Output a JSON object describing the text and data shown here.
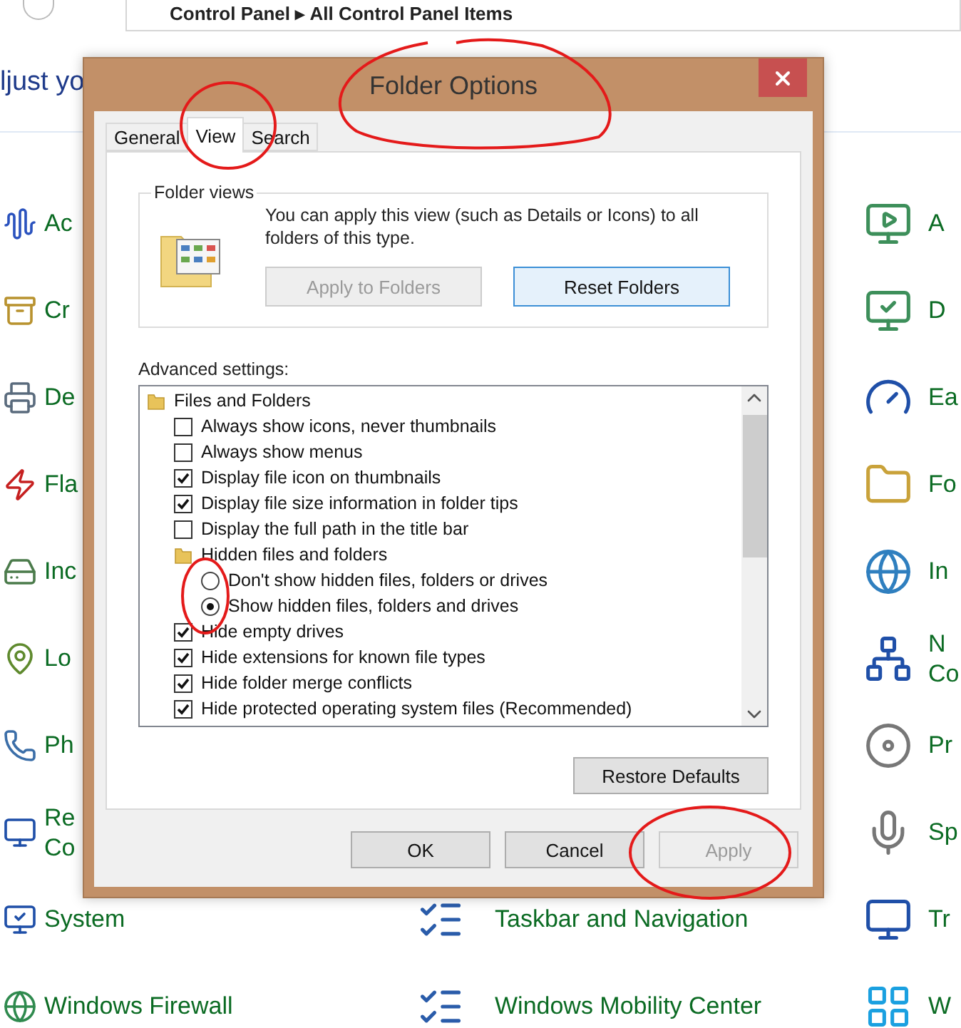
{
  "control_panel": {
    "address": "Control Panel ▸ All Control Panel Items",
    "heading": "ljust yo",
    "left_column": [
      {
        "lines": [
          "Ac"
        ]
      },
      {
        "lines": [
          "Cr"
        ]
      },
      {
        "lines": [
          "De"
        ]
      },
      {
        "lines": [
          "Fla"
        ]
      },
      {
        "lines": [
          "Inc"
        ]
      },
      {
        "lines": [
          "Lo"
        ]
      },
      {
        "lines": [
          "Ph"
        ]
      },
      {
        "lines": [
          "Re",
          "Co"
        ]
      },
      {
        "lines": [
          "System"
        ]
      },
      {
        "lines": [
          "Windows Firewall"
        ]
      }
    ],
    "middle_column": [
      {
        "lines": [
          "Taskbar and Navigation"
        ]
      },
      {
        "lines": [
          "Windows Mobility Center"
        ]
      }
    ],
    "right_column": [
      {
        "lines": [
          "A"
        ]
      },
      {
        "lines": [
          "D"
        ]
      },
      {
        "lines": [
          "Ea"
        ]
      },
      {
        "lines": [
          "Fo"
        ]
      },
      {
        "lines": [
          "In"
        ]
      },
      {
        "lines": [
          "N",
          "Co"
        ]
      },
      {
        "lines": [
          "Pr"
        ]
      },
      {
        "lines": [
          "Sp"
        ]
      },
      {
        "lines": [
          "Tr"
        ]
      },
      {
        "lines": [
          "W"
        ]
      }
    ]
  },
  "dialog": {
    "title": "Folder Options",
    "tabs": [
      {
        "label": "General",
        "selected": false
      },
      {
        "label": "View",
        "selected": true
      },
      {
        "label": "Search",
        "selected": false
      }
    ],
    "folder_views": {
      "legend": "Folder views",
      "description": "You can apply this view (such as Details or Icons) to all folders of this type.",
      "buttons": [
        {
          "label": "Apply to Folders",
          "disabled": true,
          "default": false
        },
        {
          "label": "Reset Folders",
          "disabled": false,
          "default": true
        }
      ]
    },
    "advanced_label": "Advanced settings:",
    "tree": [
      {
        "kind": "folder",
        "label": "Files and Folders",
        "children": [
          {
            "kind": "checkbox",
            "label": "Always show icons, never thumbnails",
            "checked": false
          },
          {
            "kind": "checkbox",
            "label": "Always show menus",
            "checked": false
          },
          {
            "kind": "checkbox",
            "label": "Display file icon on thumbnails",
            "checked": true
          },
          {
            "kind": "checkbox",
            "label": "Display file size information in folder tips",
            "checked": true
          },
          {
            "kind": "checkbox",
            "label": "Display the full path in the title bar",
            "checked": false
          },
          {
            "kind": "folder",
            "label": "Hidden files and folders",
            "children": [
              {
                "kind": "radio",
                "label": "Don't show hidden files, folders or drives",
                "selected": false
              },
              {
                "kind": "radio",
                "label": "Show hidden files, folders and drives",
                "selected": true
              }
            ]
          },
          {
            "kind": "checkbox",
            "label": "Hide empty drives",
            "checked": true
          },
          {
            "kind": "checkbox",
            "label": "Hide extensions for known file types",
            "checked": true
          },
          {
            "kind": "checkbox",
            "label": "Hide folder merge conflicts",
            "checked": true
          },
          {
            "kind": "checkbox",
            "label": "Hide protected operating system files (Recommended)",
            "checked": true
          }
        ]
      }
    ],
    "restore_button": "Restore Defaults",
    "buttons": [
      {
        "label": "OK",
        "disabled": false
      },
      {
        "label": "Cancel",
        "disabled": false
      },
      {
        "label": "Apply",
        "disabled": true
      }
    ]
  }
}
